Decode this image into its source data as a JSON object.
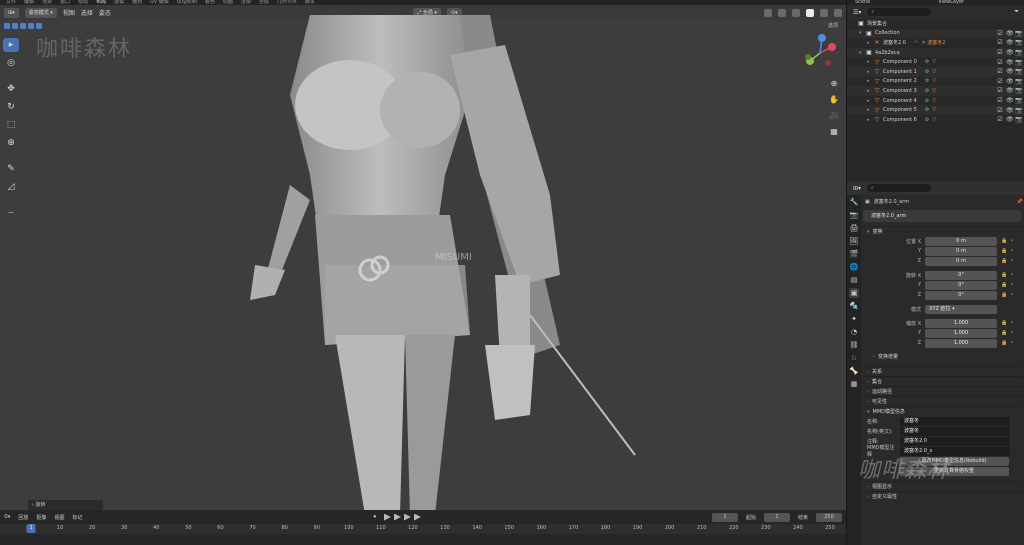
{
  "menubar": [
    "文件",
    "编辑",
    "渲染",
    "窗口",
    "帮助",
    "布局",
    "建模",
    "雕刻",
    "UV 编辑",
    "纹理绘制",
    "着色",
    "动画",
    "渲染",
    "合成",
    "几何节点",
    "脚本"
  ],
  "menubar_active_index": 5,
  "viewport": {
    "mode_label": "姿态模式",
    "menus": [
      "视图",
      "选择",
      "姿态"
    ],
    "transform_orientation": "全局",
    "options_label": "选项",
    "watermark": "咖啡森林",
    "model_watermark": "MISUMI",
    "operator_panel": "旋转"
  },
  "tools": [
    "select-box-icon",
    "cursor-icon",
    "move-icon",
    "rotate-icon",
    "scale-icon",
    "transform-icon",
    "annotate-icon",
    "measure-icon",
    "pose-relax-icon"
  ],
  "timeline": {
    "menus": [
      "回放",
      "抠像",
      "视图",
      "标记"
    ],
    "current_frame": "1",
    "start_label": "起始",
    "start": "1",
    "end_label": "结束",
    "end": "250",
    "ticks": [
      "0",
      "10",
      "20",
      "30",
      "40",
      "50",
      "60",
      "70",
      "80",
      "90",
      "100",
      "110",
      "120",
      "130",
      "140",
      "150",
      "160",
      "170",
      "180",
      "190",
      "200",
      "210",
      "220",
      "230",
      "240",
      "250"
    ]
  },
  "top_tabs": [
    "Scene",
    "ViewLayer"
  ],
  "outliner": {
    "rows": [
      {
        "indent": 0,
        "arrow": "",
        "icon": "▣",
        "icon_color": "white",
        "label": "场景集合",
        "badges": [],
        "vis": false
      },
      {
        "indent": 1,
        "arrow": "▾",
        "icon": "▣",
        "icon_color": "white",
        "label": "Collection",
        "badges": [],
        "vis": true
      },
      {
        "indent": 2,
        "arrow": "▸",
        "icon": "✕",
        "icon_color": "orange",
        "label": "波塞冬2.0",
        "badges": [
          "♘",
          "✕ 波塞冬2"
        ],
        "vis": true
      },
      {
        "indent": 1,
        "arrow": "▾",
        "icon": "▣",
        "icon_color": "white",
        "label": "4a2b2eca",
        "badges": [],
        "vis": true
      },
      {
        "indent": 2,
        "arrow": "▸",
        "icon": "▽",
        "icon_color": "orange",
        "label": "Component 0",
        "badges": [
          "⚙",
          "▽"
        ],
        "vis": true
      },
      {
        "indent": 2,
        "arrow": "▸",
        "icon": "▽",
        "icon_color": "orange",
        "label": "Component 1",
        "badges": [
          "⚙",
          "▽"
        ],
        "vis": true
      },
      {
        "indent": 2,
        "arrow": "▸",
        "icon": "▽",
        "icon_color": "orange",
        "label": "Component 2",
        "badges": [
          "⚙",
          "▽"
        ],
        "vis": true
      },
      {
        "indent": 2,
        "arrow": "▸",
        "icon": "▽",
        "icon_color": "orange",
        "label": "Component 3",
        "badges": [
          "⚙",
          "▽"
        ],
        "vis": true
      },
      {
        "indent": 2,
        "arrow": "▸",
        "icon": "▽",
        "icon_color": "orange",
        "label": "Component 4",
        "badges": [
          "⚙",
          "▽"
        ],
        "vis": true
      },
      {
        "indent": 2,
        "arrow": "▸",
        "icon": "▽",
        "icon_color": "orange",
        "label": "Component 5",
        "badges": [
          "⚙",
          "▽"
        ],
        "vis": true
      },
      {
        "indent": 2,
        "arrow": "▸",
        "icon": "▽",
        "icon_color": "orange",
        "label": "Component 6",
        "badges": [
          "⚙",
          "▽"
        ],
        "vis": true
      }
    ]
  },
  "properties": {
    "path": "波塞冬2.0_arm",
    "object_name": "波塞冬2.0_arm",
    "transform": {
      "header": "变换",
      "location_label": "位置 X",
      "location": [
        "0 m",
        "0 m",
        "0 m"
      ],
      "rotation_label": "旋转 X",
      "rotation": [
        "0°",
        "0°",
        "0°"
      ],
      "mode_label": "模式",
      "mode": "XYZ 欧拉",
      "scale_label": "缩放 X",
      "scale": [
        "1.000",
        "1.000",
        "1.000"
      ],
      "delta": "变换增量"
    },
    "sections": [
      "关系",
      "集合",
      "运动路径",
      "可见性"
    ],
    "mmd": {
      "header": "MMD模型信息",
      "name_label": "名称:",
      "name": "波塞冬",
      "name_en_label": "名称(英文):",
      "name_en": "波塞冬",
      "comment_label": "注释:",
      "comment": "波塞冬2.0",
      "comment_en_label": "MMD模型注释",
      "comment_en": "波塞冬2.0_s",
      "btn1": "更改MMD模型信息(Rebuild)",
      "btn2": "重新计算骨骼权重"
    },
    "bottom_sections": [
      "视图显示",
      "自定义属性"
    ]
  },
  "colors": {
    "accent": "#4772b3",
    "orange": "#e8903c",
    "green": "#5fc27a"
  }
}
